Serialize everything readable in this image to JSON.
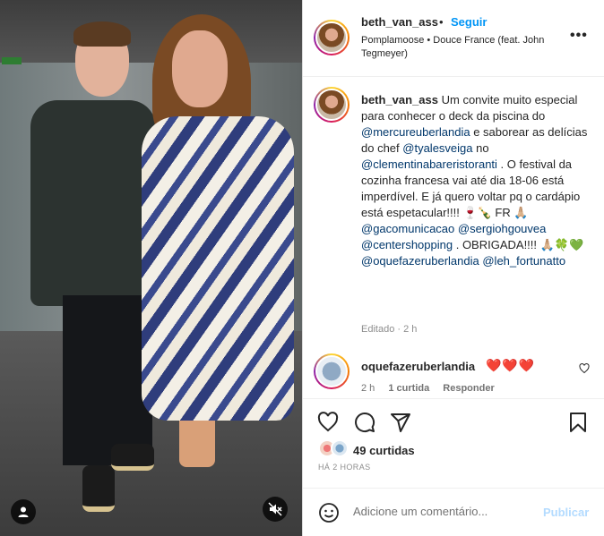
{
  "post": {
    "username": "beth_van_ass",
    "follow_label": "Seguir",
    "separator": "•",
    "audio": "Pomplamoose • Douce France (feat. John Tegmeyer)",
    "more_label": "•••"
  },
  "caption": {
    "username": "beth_van_ass",
    "t1": " Um convite muito especial para conhecer o deck da piscina do ",
    "m1": "@mercureuberlandia",
    "t2": " e saborear as delícias do chef ",
    "m2": "@tyalesveiga",
    "t3": " no ",
    "m3": "@clementinabareristoranti",
    "t4": " . O festival da cozinha francesa vai até dia 18-06 está imperdível. E já quero voltar pq o cardápio está espetacular!!!! 🍷🍾 FR 🙏🏼 ",
    "m4": "@gacomunicacao",
    "t5": " ",
    "m5": "@sergiohgouvea",
    "t6": " ",
    "m6": "@centershopping",
    "t7": " . OBRIGADA!!!! 🙏🏼🍀💚 ",
    "m7": "@oquefazeruberlandia",
    "t8": " ",
    "m8": "@leh_fortunatto",
    "meta": "Editado · 2 h"
  },
  "comment": {
    "username": "oquefazeruberlandia",
    "text": "❤️❤️❤️",
    "time": "2 h",
    "likes": "1 curtida",
    "reply": "Responder"
  },
  "actions": {
    "likes_count": "49 curtidas",
    "time": "HÁ 2 HORAS"
  },
  "add_comment": {
    "placeholder": "Adicione um comentário...",
    "publish": "Publicar"
  },
  "colors": {
    "accent": "#0095f6",
    "mention": "#00376b",
    "muted": "#8e8e8e"
  }
}
